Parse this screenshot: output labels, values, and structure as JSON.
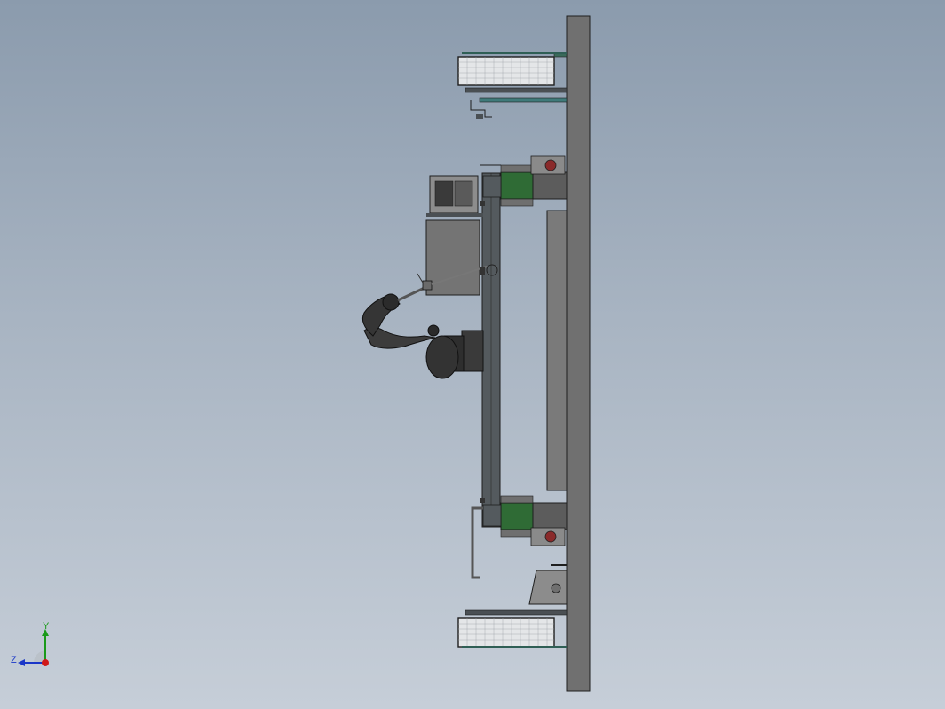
{
  "viewport": {
    "background_top": "#8b9bad",
    "background_bottom": "#c6ced8"
  },
  "colors": {
    "steel": "#6f6f6f",
    "dark_steel": "#4a4f53",
    "edge": "#1e1e1e",
    "green_drive": "#2f6b35",
    "red_motor": "#8a2a2a",
    "robot": "#3a3a3a",
    "fence_fill": "#e4e6e8"
  },
  "triad": {
    "x_label": "",
    "y_label": "Y",
    "z_label": "Z",
    "x_color": "#d01818",
    "y_color": "#1a9a1a",
    "z_color": "#1a36c8"
  }
}
